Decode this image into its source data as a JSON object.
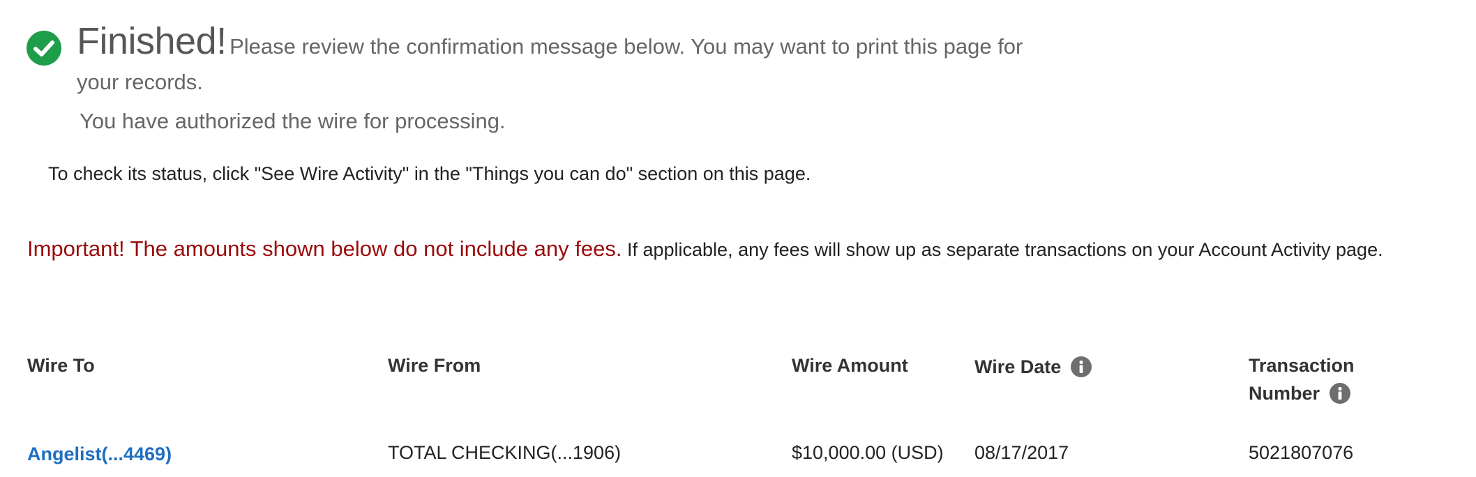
{
  "confirmation": {
    "title": "Finished!",
    "message_part1": "Please review the confirmation message below. You may want to print this page for",
    "message_part2": "your records.",
    "authorized": "You have authorized the wire for processing.",
    "status_hint": "To check its status, click \"See Wire Activity\" in the \"Things you can do\" section on this page."
  },
  "notice": {
    "important": "Important! The amounts shown below do not include any fees.",
    "details": "If applicable, any fees will show up as separate transactions on your Account Activity page."
  },
  "table": {
    "headers": {
      "wire_to": "Wire To",
      "wire_from": "Wire From",
      "wire_amount": "Wire Amount",
      "wire_date": "Wire Date",
      "transaction_line1": "Transaction",
      "transaction_line2": "Number"
    },
    "row": {
      "wire_to": "Angelist(...4469)",
      "wire_from": "TOTAL CHECKING(...1906)",
      "wire_amount": "$10,000.00 (USD)",
      "wire_date": "08/17/2017",
      "transaction_number": "5021807076"
    }
  },
  "icons": {
    "success": "check-circle-icon",
    "info": "info-icon"
  },
  "colors": {
    "success_green": "#1e9e4a",
    "important_red": "#9b0a0a",
    "link_blue": "#1f6fc2",
    "info_gray": "#6e6e6e"
  }
}
